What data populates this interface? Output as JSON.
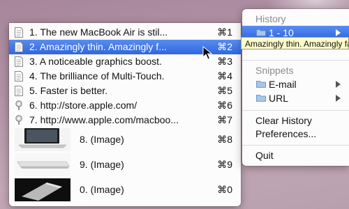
{
  "history_submenu": {
    "items": [
      {
        "label": "1. The new MacBook Air is stil...",
        "shortcut": "⌘1",
        "icon": "text-document-icon"
      },
      {
        "label": "2. Amazingly thin. Amazingly f...",
        "shortcut": "⌘2",
        "icon": "text-document-icon",
        "selected": true
      },
      {
        "label": "3. A noticeable graphics boost.",
        "shortcut": "⌘3",
        "icon": "text-document-icon"
      },
      {
        "label": "4. The brilliance of Multi-Touch.",
        "shortcut": "⌘4",
        "icon": "text-document-icon"
      },
      {
        "label": "5. Faster is better.",
        "shortcut": "⌘5",
        "icon": "text-document-icon"
      },
      {
        "label": "6. http://store.apple.com/",
        "shortcut": "⌘6",
        "icon": "url-pin-icon"
      },
      {
        "label": "7. http://www.apple.com/macboo...",
        "shortcut": "⌘7",
        "icon": "url-pin-icon"
      }
    ],
    "image_items": [
      {
        "label": "8. (Image)",
        "shortcut": "⌘8",
        "icon": "laptop-thumbnail-icon"
      },
      {
        "label": "9. (Image)",
        "shortcut": "⌘9",
        "icon": "laptop-closed-thumbnail-icon"
      },
      {
        "label": "0. (Image)",
        "shortcut": "⌘0",
        "icon": "laptop-dark-thumbnail-icon"
      }
    ]
  },
  "main_menu": {
    "history_header": "History",
    "history_range": "1 - 10",
    "snippets_header": "Snippets",
    "snippet_email": "E-mail",
    "snippet_url": "URL",
    "clear_history": "Clear History",
    "preferences": "Preferences...",
    "quit": "Quit"
  },
  "tooltip": {
    "text": "Amazingly thin. Amazingly fast."
  },
  "colors": {
    "selection": "#3b73e6",
    "tooltip_bg": "#fefbc9",
    "header_gray": "#8b8b8b"
  }
}
